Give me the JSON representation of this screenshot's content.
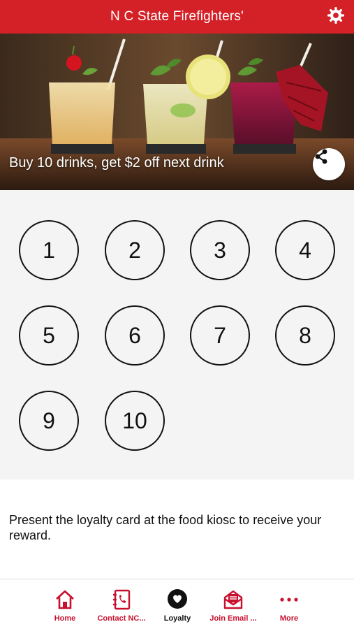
{
  "header": {
    "title": "N C State Firefighters'",
    "settings_icon": "gear-icon"
  },
  "hero": {
    "caption": "Buy 10 drinks, get $2 off next drink",
    "share_icon": "share-icon"
  },
  "loyalty": {
    "stamps": [
      "1",
      "2",
      "3",
      "4",
      "5",
      "6",
      "7",
      "8",
      "9",
      "10"
    ]
  },
  "note": "Present the loyalty card at the food kiosc to receive your reward.",
  "tabs": [
    {
      "label": "Home",
      "icon": "home-icon"
    },
    {
      "label": "Contact NC...",
      "icon": "contact-book-icon"
    },
    {
      "label": "Loyalty",
      "icon": "loyalty-heart-icon"
    },
    {
      "label": "Join Email ...",
      "icon": "mail-icon"
    },
    {
      "label": "More",
      "icon": "more-dots-icon"
    }
  ],
  "colors": {
    "brand_red": "#d42027",
    "tab_red": "#c8102e",
    "active_tab": "#111111",
    "stamp_area_bg": "#f4f4f4"
  }
}
